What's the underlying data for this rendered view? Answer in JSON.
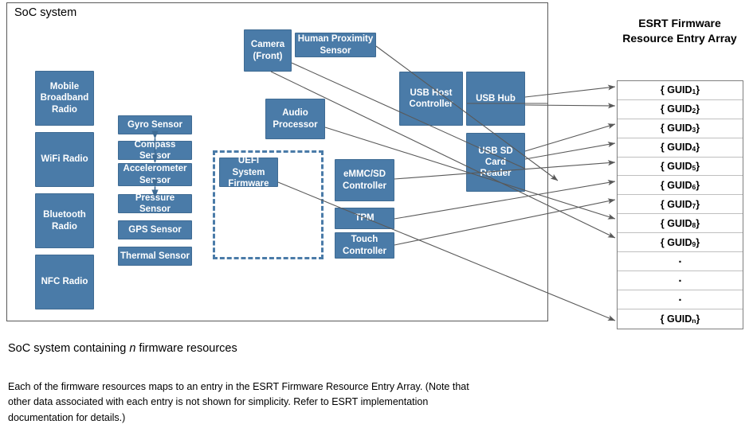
{
  "diagram": {
    "soc_title": "SoC system",
    "esrt_title_line1": "ESRT Firmware",
    "esrt_title_line2": "Resource Entry Array",
    "colors": {
      "node_fill": "#4a7ba8",
      "node_border": "#3f6b93",
      "frame_border": "#595959",
      "table_border": "#7f7f7f",
      "wire": "#595959"
    },
    "nodes": {
      "mobile_broadband_radio": "Mobile Broadband Radio",
      "wifi_radio": "WiFi Radio",
      "bluetooth_radio": "Bluetooth Radio",
      "nfc_radio": "NFC Radio",
      "gyro_sensor": "Gyro Sensor",
      "compass_sensor": "Compass Sensor",
      "accelerometer_sensor": "Accelerometer Sensor",
      "pressure_sensor": "Pressure Sensor",
      "gps_sensor": "GPS Sensor",
      "thermal_sensor": "Thermal Sensor",
      "camera_front": "Camera (Front)",
      "human_proximity_sensor": "Human Proximity Sensor",
      "audio_processor": "Audio Processor",
      "uefi_system_firmware": "UEFI System Firmware",
      "emmc_sd_controller": "eMMC/SD Controller",
      "tpm": "TPM",
      "touch_controller": "Touch Controller",
      "usb_host_controller": "USB Host Controller",
      "usb_hub": "USB Hub",
      "usb_sd_card_reader": "USB SD Card Reader"
    },
    "guid_rows": [
      {
        "label": "{ GUID1 }",
        "base": "{ GUID",
        "sub": "1",
        "tail": " }",
        "kind": "guid"
      },
      {
        "label": "{ GUID2 }",
        "base": "{ GUID",
        "sub": "2",
        "tail": " }",
        "kind": "guid"
      },
      {
        "label": "{ GUID3 }",
        "base": "{ GUID",
        "sub": "3",
        "tail": " }",
        "kind": "guid"
      },
      {
        "label": "{ GUID4 }",
        "base": "{ GUID",
        "sub": "4",
        "tail": " }",
        "kind": "guid"
      },
      {
        "label": "{ GUID5 }",
        "base": "{ GUID",
        "sub": "5",
        "tail": " }",
        "kind": "guid"
      },
      {
        "label": "{ GUID6 }",
        "base": "{ GUID",
        "sub": "6",
        "tail": " }",
        "kind": "guid"
      },
      {
        "label": "{ GUID7 }",
        "base": "{ GUID",
        "sub": "7",
        "tail": " }",
        "kind": "guid"
      },
      {
        "label": "{ GUID8 }",
        "base": "{ GUID",
        "sub": "8",
        "tail": " }",
        "kind": "guid"
      },
      {
        "label": "{ GUID9 }",
        "base": "{ GUID",
        "sub": "9",
        "tail": " }",
        "kind": "guid"
      },
      {
        "label": ".",
        "base": ".",
        "sub": "",
        "tail": "",
        "kind": "dots"
      },
      {
        "label": ".",
        "base": ".",
        "sub": "",
        "tail": "",
        "kind": "dots"
      },
      {
        "label": ".",
        "base": ".",
        "sub": "",
        "tail": "",
        "kind": "dots"
      },
      {
        "label": "{ GUIDn }",
        "base": "{ GUID",
        "sub": "n",
        "tail": " }",
        "kind": "guid"
      }
    ]
  },
  "caption": {
    "heading_before": "SoC system containing ",
    "heading_italic": "n",
    "heading_after": " firmware resources",
    "body": "Each of the firmware resources maps to an entry in the ESRT Firmware Resource Entry Array. (Note that other data associated with each entry is not shown for simplicity. Refer to ESRT implementation documentation for details.)"
  }
}
